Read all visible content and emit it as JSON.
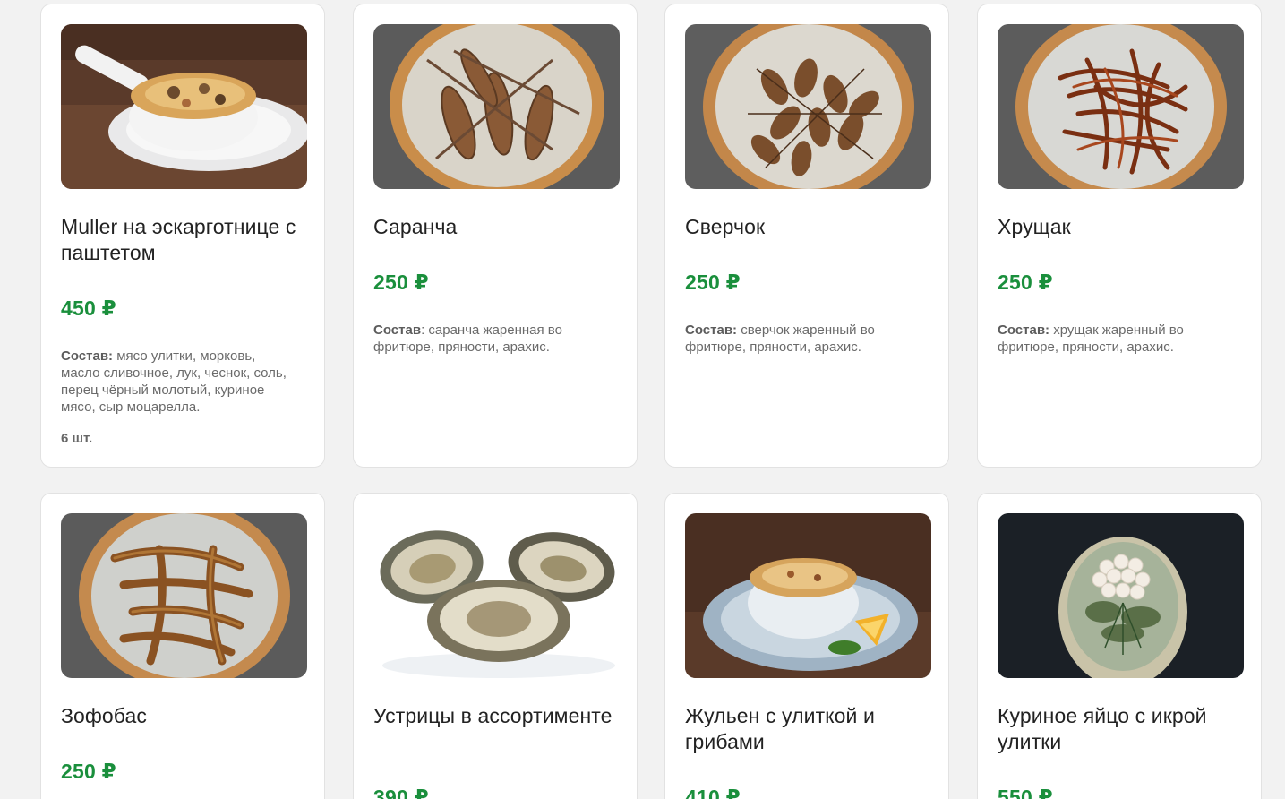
{
  "colors": {
    "page_background": "#f2f2f2",
    "card_background": "#ffffff",
    "price": "#1a8f3c",
    "title": "#222222",
    "muted": "#6a6a6a"
  },
  "products": [
    {
      "name": "Muller на эскарготнице с паштетом",
      "price": "450 ₽",
      "composition_label": "Состав:",
      "composition": " мясо улитки, морковь, масло сливочное, лук, чеснок, соль, перец чёрный молотый, куриное мясо, сыр моцарелла.",
      "quantity": "6 шт.",
      "image": "snail-casserole-photo"
    },
    {
      "name": "Саранча",
      "price": "250 ₽",
      "composition_label": "Состав",
      "composition": ": саранча жаренная во фритюре, пряности, арахис.",
      "image": "fried-locust-photo"
    },
    {
      "name": "Сверчок",
      "price": "250 ₽",
      "composition_label": "Состав:",
      "composition": " сверчок жаренный во фритюре, пряности, арахис.",
      "image": "fried-cricket-photo"
    },
    {
      "name": "Хрущак",
      "price": "250 ₽",
      "composition_label": "Состав:",
      "composition": " хрущак жаренный во фритюре, пряности, арахис.",
      "image": "fried-mealworm-photo"
    },
    {
      "name": "Зофобас",
      "price": "250 ₽",
      "image": "fried-zophobas-photo"
    },
    {
      "name": "Устрицы в ассортименте",
      "price": "390 ₽",
      "image": "oysters-photo"
    },
    {
      "name": "Жульен с улиткой и грибами",
      "price": "410 ₽",
      "image": "julienne-photo"
    },
    {
      "name": "Куриное яйцо с икрой улитки",
      "price": "550 ₽",
      "image": "egg-snail-caviar-photo"
    }
  ]
}
